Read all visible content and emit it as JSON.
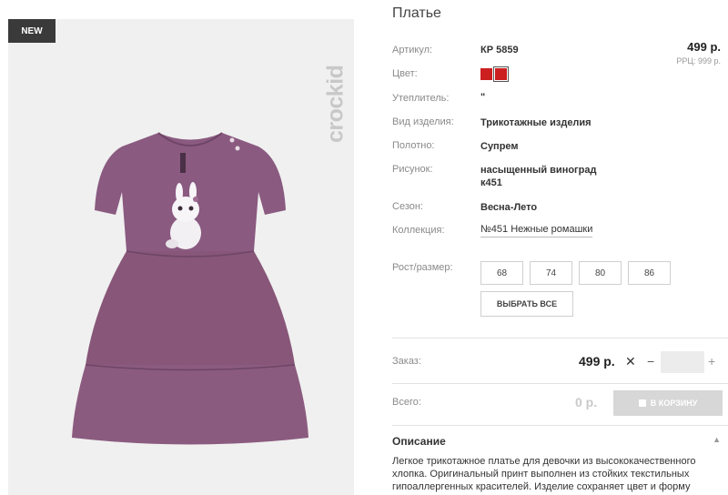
{
  "badge": "NEW",
  "brand_logo_text": "crockid",
  "title": "Платье",
  "article": {
    "label": "Артикул:",
    "value": "КР 5859"
  },
  "price": "499 р.",
  "rrp": "РРЦ: 999 р.",
  "color": {
    "label": "Цвет:",
    "swatches": [
      "#cc1f1f",
      "#cc1f1f"
    ]
  },
  "insulation": {
    "label": "Утеплитель:",
    "value": "\""
  },
  "product_type": {
    "label": "Вид изделия:",
    "value": "Трикотажные изделия"
  },
  "fabric": {
    "label": "Полотно:",
    "value": "Супрем"
  },
  "print": {
    "label": "Рисунок:",
    "value_line1": "насыщенный виноград",
    "value_line2": "к451"
  },
  "season": {
    "label": "Сезон:",
    "value": "Весна-Лето"
  },
  "collection": {
    "label": "Коллекция:",
    "value": "№451 Нежные ромашки"
  },
  "sizes": {
    "label": "Рост/размер:",
    "options": [
      "68",
      "74",
      "80",
      "86"
    ],
    "select_all": "ВЫБРАТЬ ВСЕ"
  },
  "order": {
    "label": "Заказ:",
    "price": "499 р.",
    "remove": "✕",
    "minus": "−",
    "qty": "",
    "plus": "+"
  },
  "total": {
    "label": "Всего:",
    "price": "0 р.",
    "cart_button": "В КОРЗИНУ"
  },
  "description": {
    "title": "Описание",
    "toggle": "▲",
    "text": "Легкое трикотажное платье для девочки из высококачественного хлопка. Оригинальный принт выполнен из стойких текстильных гипоаллергенных красителей. Изделие сохраняет цвет и форму"
  }
}
